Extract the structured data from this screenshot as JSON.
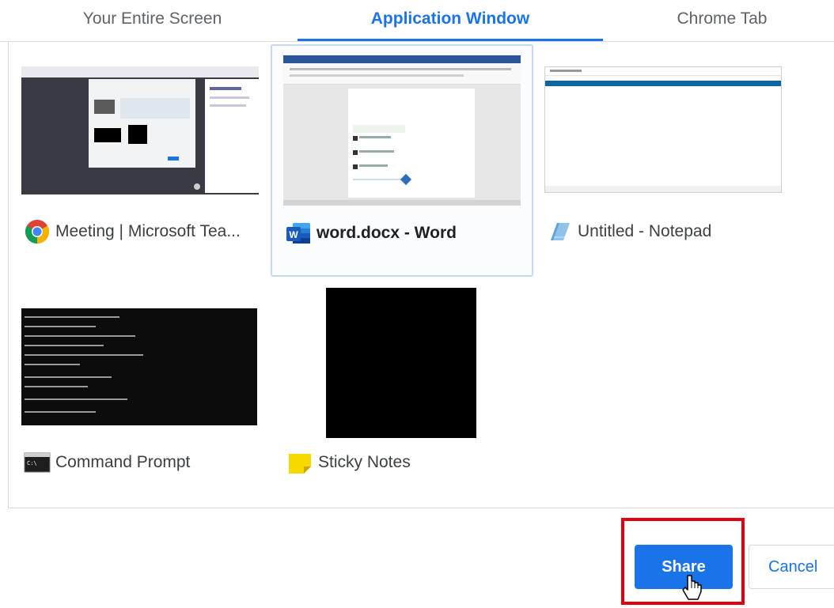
{
  "tabs": [
    {
      "label": "Your Entire Screen",
      "active": false
    },
    {
      "label": "Application Window",
      "active": true
    },
    {
      "label": "Chrome Tab",
      "active": false
    }
  ],
  "windows": [
    {
      "title": "Meeting | Microsoft Tea...",
      "icon": "chrome-icon",
      "selected": false
    },
    {
      "title": "word.docx - Word",
      "icon": "word-icon",
      "selected": true
    },
    {
      "title": "Untitled - Notepad",
      "icon": "notepad-icon",
      "selected": false
    },
    {
      "title": "Command Prompt",
      "icon": "command-prompt-icon",
      "selected": false
    },
    {
      "title": "Sticky Notes",
      "icon": "sticky-notes-icon",
      "selected": false
    }
  ],
  "buttons": {
    "share": "Share",
    "cancel": "Cancel"
  },
  "colors": {
    "accent": "#1a73e8",
    "highlight_box": "#e0000f",
    "text": "#3c4043"
  }
}
